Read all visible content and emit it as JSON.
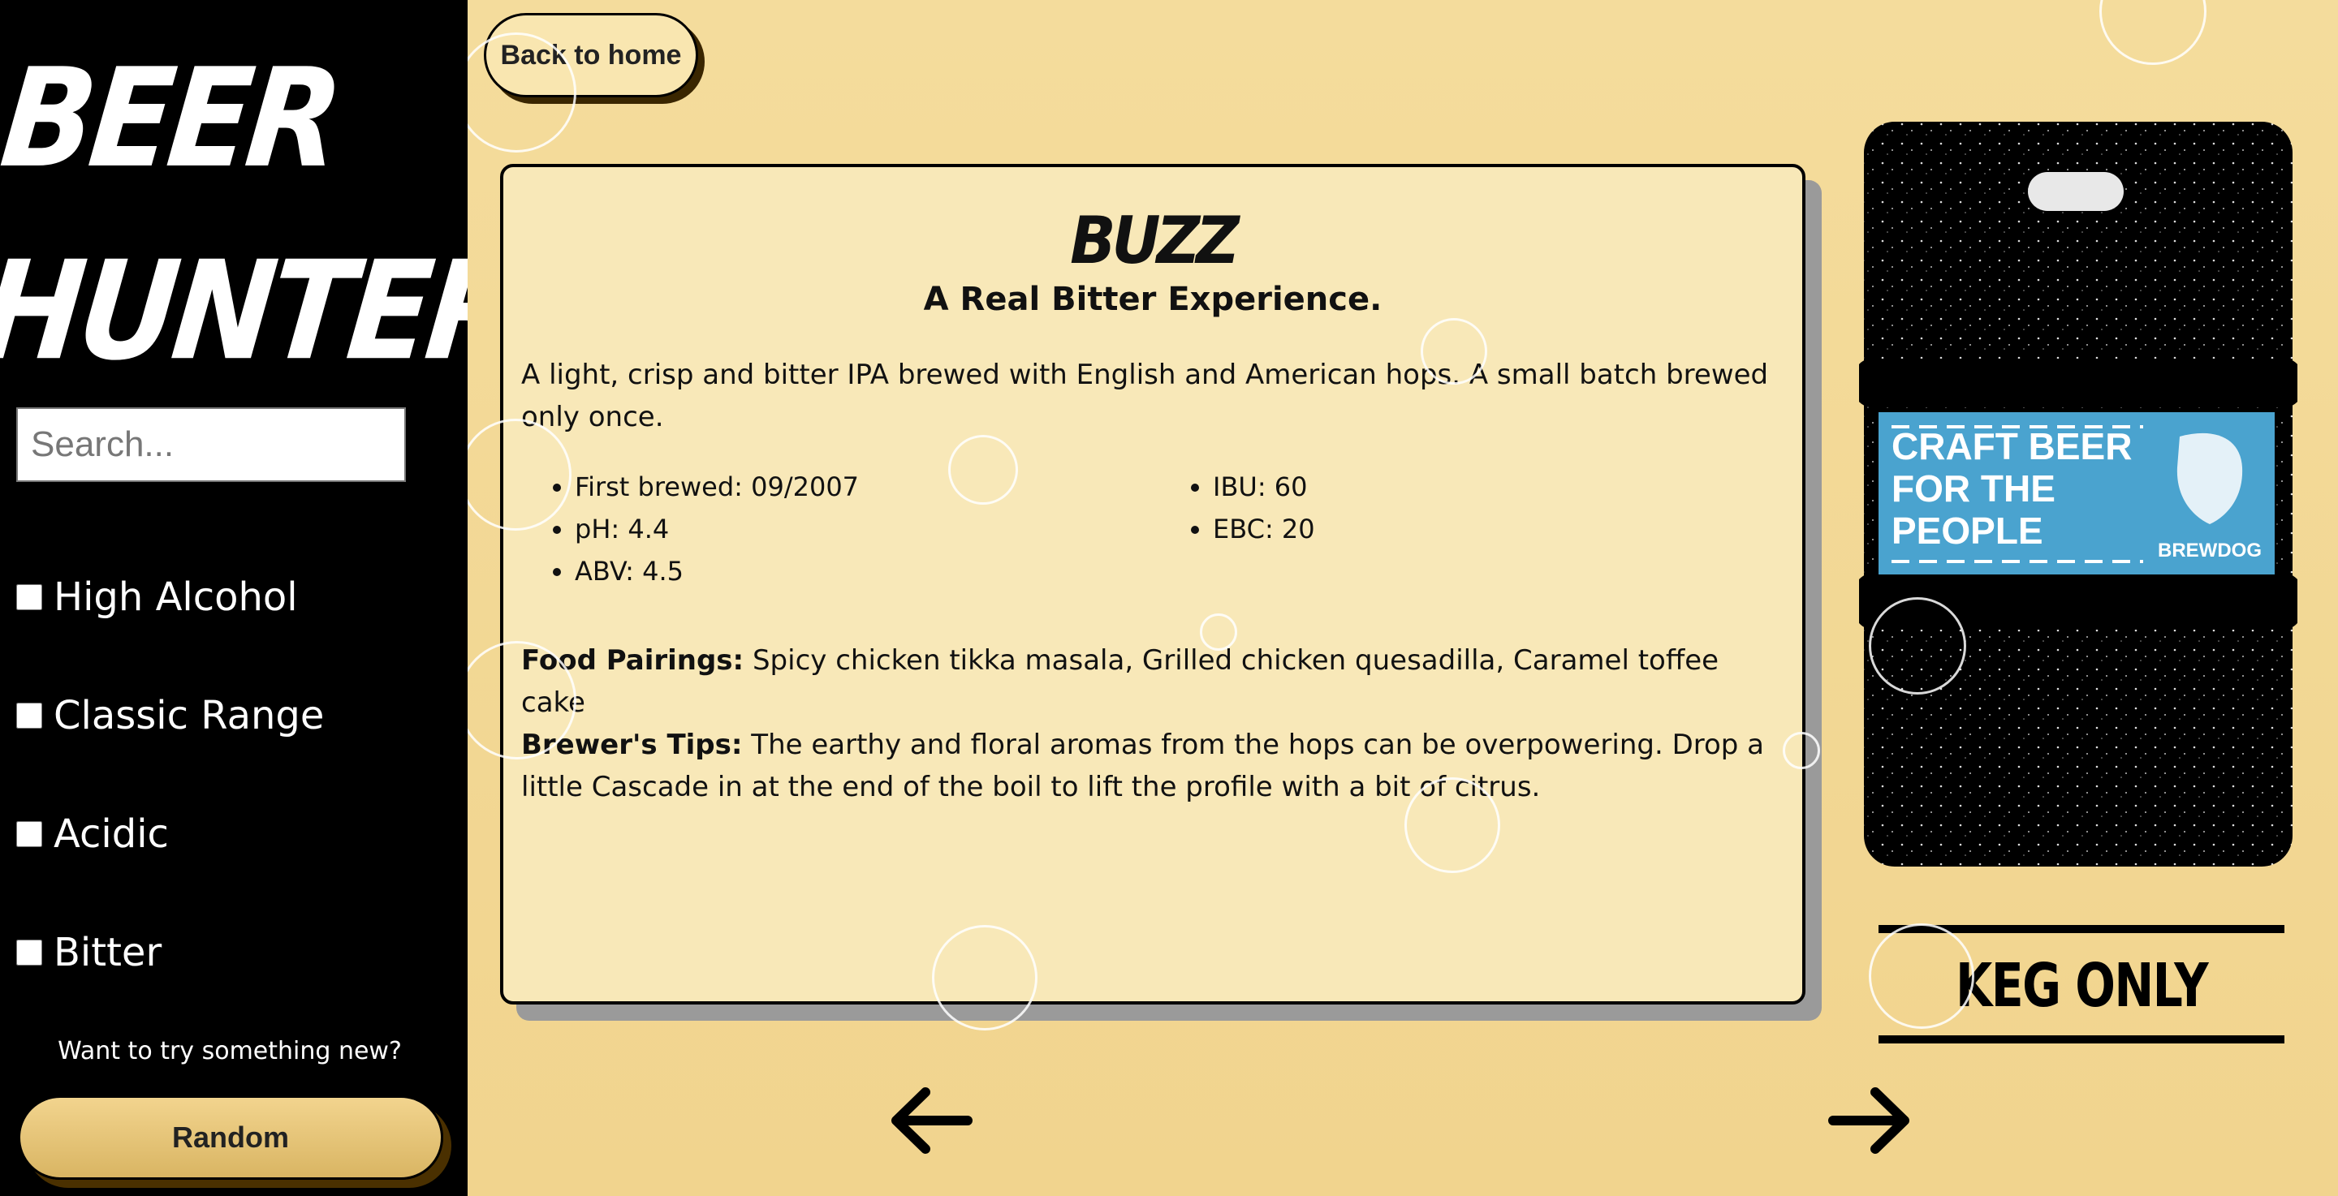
{
  "sidebar": {
    "logo_line1": "BEER",
    "logo_line2": "HUNTER",
    "search_placeholder": "Search...",
    "filters": [
      "High Alcohol",
      "Classic Range",
      "Acidic",
      "Bitter"
    ],
    "random_prompt": "Want to try something new?",
    "random_label": "Random"
  },
  "main": {
    "back_label": "Back to home",
    "beer": {
      "name": "BUZZ",
      "tagline": "A Real Bitter Experience.",
      "description": "A light, crisp and bitter IPA brewed with English and American hops. A small batch brewed only once.",
      "stats_left": [
        "First brewed: 09/2007",
        "pH: 4.4",
        "ABV: 4.5"
      ],
      "stats_right": [
        "IBU: 60",
        "EBC: 20"
      ],
      "food_label": "Food Pairings:",
      "food_value": "Spicy chicken tikka masala, Grilled chicken quesadilla, Caramel toffee cake",
      "tips_label": "Brewer's Tips:",
      "tips_value": "The earthy and floral aromas from the hops can be overpowering. Drop a little Cascade in at the end of the boil to lift the profile with a bit of citrus."
    },
    "image_label": {
      "line1": "CRAFT BEER",
      "line2": "FOR THE",
      "line3": "PEOPLE",
      "brand": "BREWDOG"
    },
    "keg_label": "KEG ONLY",
    "prev_icon": "arrow-left-icon",
    "next_icon": "arrow-right-icon"
  },
  "colors": {
    "background": "#f3d896",
    "sidebar": "#000000",
    "card": "#f8e8b8",
    "button": "#e9c97a",
    "label_blue": "#4aa3cf"
  }
}
